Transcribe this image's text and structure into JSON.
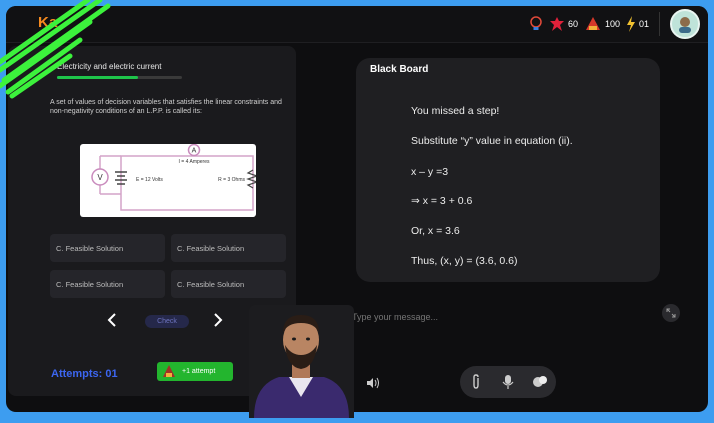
{
  "app": {
    "logo_text": "Ka"
  },
  "stats": {
    "gems": "60",
    "trophies": "100",
    "energy": "01"
  },
  "quiz": {
    "topic": "Electricity and electric current",
    "progress_percent": 65,
    "question": "A set of values of decision variables that satisfies the linear constraints and non-negativity conditions of an L.P.P. is called its:",
    "circuit": {
      "ammeter": "A",
      "current": "I = 4 Amperes",
      "voltmeter": "V",
      "emf": "E = 12 Volts",
      "resistance": "R = 3 Ohms"
    },
    "options": [
      "C. Feasible Solution",
      "C. Feasible Solution",
      "C. Feasible Solution",
      "C. Feasible Solution"
    ],
    "check_label": "Check",
    "attempts_label": "Attempts: 01",
    "attempt_button_label": "+1 attempt"
  },
  "blackboard": {
    "title": "Black Board",
    "lines": [
      "You missed a step!",
      "Substitute “y” value in equation (ii).",
      "x – y =3",
      "⇒ x = 3 + 0.6",
      "Or, x = 3.6",
      "Thus, (x, y) = (3.6, 0.6)"
    ]
  },
  "chat": {
    "placeholder": "Type your message..."
  },
  "colors": {
    "accent_orange": "#f58a1f",
    "progress_green": "#1ec44a",
    "attempts_blue": "#3c66f0",
    "badge_green": "#23b52e",
    "frame_blue": "#3d9df0"
  }
}
